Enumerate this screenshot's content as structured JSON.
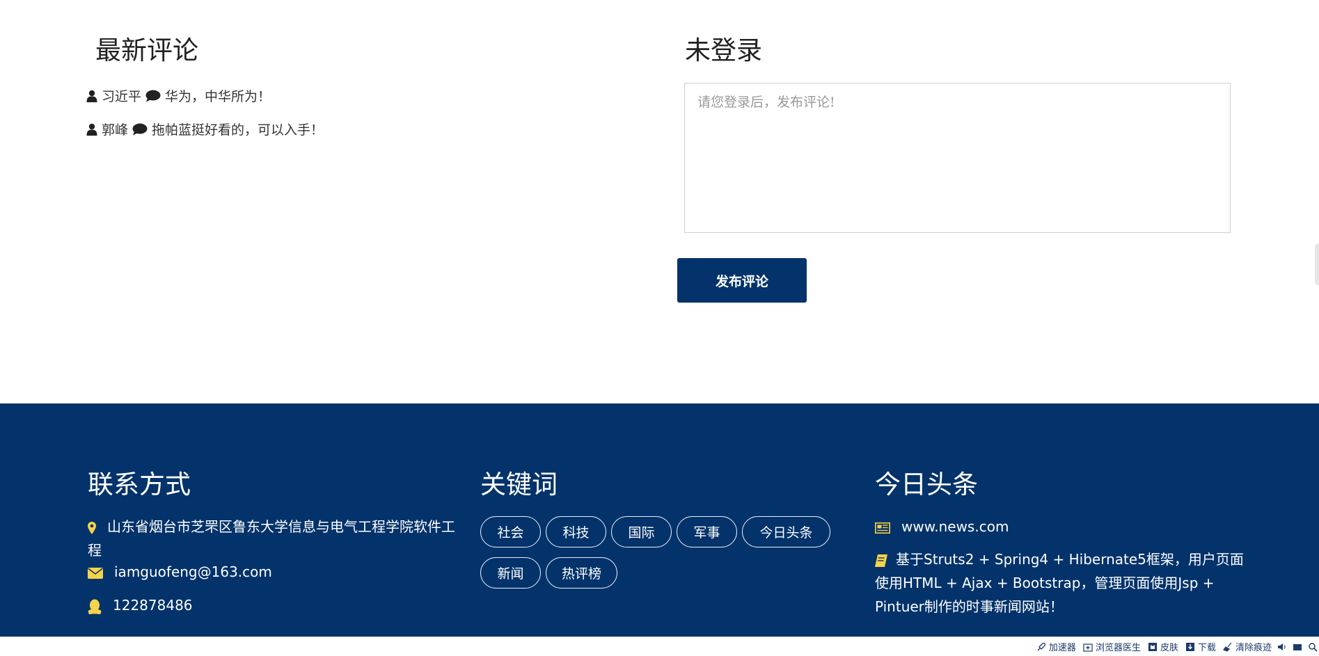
{
  "comments_section": {
    "title": "最新评论",
    "items": [
      {
        "user": "习近平",
        "text": "华为，中华所为！"
      },
      {
        "user": "郭峰",
        "text": "拖帕蓝挺好看的，可以入手！"
      }
    ]
  },
  "post_section": {
    "title": "未登录",
    "placeholder": "请您登录后，发布评论!",
    "submit_label": "发布评论"
  },
  "footer": {
    "contact": {
      "title": "联系方式",
      "address": "山东省烟台市芝罘区鲁东大学信息与电气工程学院软件工程",
      "email": "iamguofeng@163.com",
      "qq": "122878486"
    },
    "keywords": {
      "title": "关键词",
      "tags": [
        "社会",
        "科技",
        "国际",
        "军事",
        "今日头条",
        "新闻",
        "热评榜"
      ]
    },
    "headlines": {
      "title": "今日头条",
      "site": "www.news.com",
      "description": "基于Struts2 + Spring4 + Hibernate5框架，用户页面使用HTML + Ajax + Bootstrap，管理页面使用Jsp + Pintuer制作的时事新闻网站！"
    }
  },
  "statusbar": {
    "items": [
      "加速器",
      "浏览器医生",
      "皮肤",
      "下载",
      "清除痕迹"
    ]
  },
  "colors": {
    "primary": "#03336a",
    "icon_accent": "#f5d34a"
  }
}
